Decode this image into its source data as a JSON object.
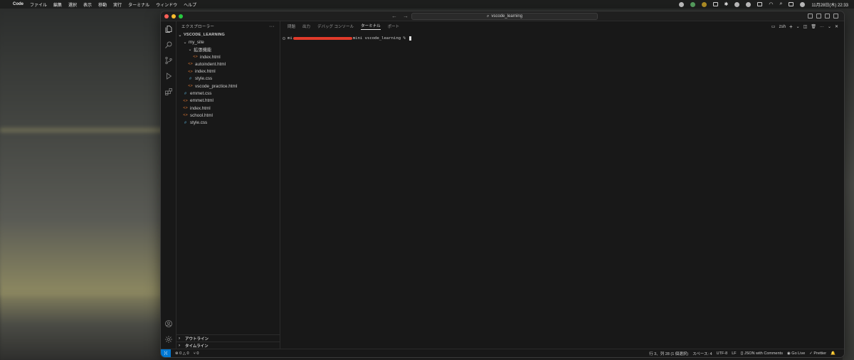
{
  "menubar": {
    "app": "Code",
    "items": [
      "ファイル",
      "編集",
      "選択",
      "表示",
      "移動",
      "実行",
      "ターミナル",
      "ウィンドウ",
      "ヘルプ"
    ],
    "clock": "11月28日(木) 22:33"
  },
  "titlebar": {
    "search_text": "vscode_learning"
  },
  "sidebar": {
    "title": "エクスプローラー",
    "root": "VSCODE_LEARNING",
    "tree": [
      {
        "label": "my_site",
        "kind": "folder",
        "depth": 1
      },
      {
        "label": "拡張機能",
        "kind": "folder",
        "depth": 2
      },
      {
        "label": "index.html",
        "kind": "html",
        "depth": 3
      },
      {
        "label": "autoindent.html",
        "kind": "html",
        "depth": 2
      },
      {
        "label": "index.html",
        "kind": "html",
        "depth": 2
      },
      {
        "label": "style.css",
        "kind": "css",
        "depth": 2
      },
      {
        "label": "vscode_practice.html",
        "kind": "html",
        "depth": 2
      },
      {
        "label": "emmet.css",
        "kind": "css",
        "depth": 1
      },
      {
        "label": "emmet.html",
        "kind": "html",
        "depth": 1
      },
      {
        "label": "index.html",
        "kind": "html",
        "depth": 1
      },
      {
        "label": "school.html",
        "kind": "html",
        "depth": 1
      },
      {
        "label": "style.css",
        "kind": "css",
        "depth": 1
      }
    ],
    "outline": "アウトライン",
    "timeline": "タイムライン"
  },
  "panel": {
    "tabs": [
      "問題",
      "出力",
      "デバッグ コンソール",
      "ターミナル",
      "ポート"
    ],
    "active_tab": "ターミナル",
    "shell": "zsh",
    "prompt_prefix": "mi",
    "prompt_suffix": "mini vscode_learning % "
  },
  "statusbar": {
    "errors": "0",
    "warnings": "0",
    "ports": "0",
    "position": "行 3、列 28 (1 個選択)",
    "spaces": "スペース: 4",
    "encoding": "UTF-8",
    "eol": "LF",
    "language": "JSON with Comments",
    "golive": "Go Live",
    "prettier": "Prettier"
  }
}
